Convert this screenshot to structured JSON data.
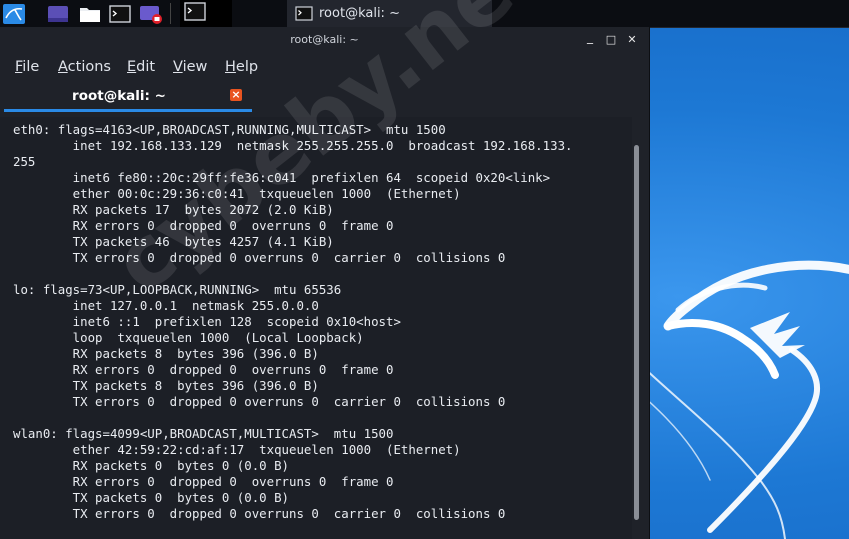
{
  "taskbar": {
    "window_task_title": "root@kali: ~",
    "icons": [
      "kali-menu-icon",
      "desktop-icon",
      "file-manager-icon",
      "terminal-icon",
      "screen-recorder-icon",
      "terminal-window-icon"
    ]
  },
  "window": {
    "title": "root@kali: ~",
    "controls": {
      "minimize": "_",
      "maximize": "□",
      "close": "✕"
    }
  },
  "menubar": {
    "items": [
      {
        "label": "File",
        "mnemonic": "F"
      },
      {
        "label": "Actions",
        "mnemonic": "A"
      },
      {
        "label": "Edit",
        "mnemonic": "E"
      },
      {
        "label": "View",
        "mnemonic": "V"
      },
      {
        "label": "Help",
        "mnemonic": "H"
      }
    ]
  },
  "tab": {
    "label": "root@kali: ~",
    "close_glyph": "×"
  },
  "terminal": {
    "lines": [
      "eth0: flags=4163<UP,BROADCAST,RUNNING,MULTICAST>  mtu 1500",
      "        inet 192.168.133.129  netmask 255.255.255.0  broadcast 192.168.133.",
      "255",
      "        inet6 fe80::20c:29ff:fe36:c041  prefixlen 64  scopeid 0x20<link>",
      "        ether 00:0c:29:36:c0:41  txqueuelen 1000  (Ethernet)",
      "        RX packets 17  bytes 2072 (2.0 KiB)",
      "        RX errors 0  dropped 0  overruns 0  frame 0",
      "        TX packets 46  bytes 4257 (4.1 KiB)",
      "        TX errors 0  dropped 0 overruns 0  carrier 0  collisions 0",
      "",
      "lo: flags=73<UP,LOOPBACK,RUNNING>  mtu 65536",
      "        inet 127.0.0.1  netmask 255.0.0.0",
      "        inet6 ::1  prefixlen 128  scopeid 0x10<host>",
      "        loop  txqueuelen 1000  (Local Loopback)",
      "        RX packets 8  bytes 396 (396.0 B)",
      "        RX errors 0  dropped 0  overruns 0  frame 0",
      "        TX packets 8  bytes 396 (396.0 B)",
      "        TX errors 0  dropped 0 overruns 0  carrier 0  collisions 0",
      "",
      "wlan0: flags=4099<UP,BROADCAST,MULTICAST>  mtu 1500",
      "        ether 42:59:22:cd:af:17  txqueuelen 1000  (Ethernet)",
      "        RX packets 0  bytes 0 (0.0 B)",
      "        RX errors 0  dropped 0  overruns 0  frame 0",
      "        TX packets 0  bytes 0 (0.0 B)",
      "        TX errors 0  dropped 0 overruns 0  carrier 0  collisions 0"
    ]
  },
  "watermark": "cybeby.net",
  "colors": {
    "accent": "#2a8ae6",
    "tab_close": "#e95420",
    "terminal_bg": "#1c1f26",
    "desktop_bg": "#1d78d4"
  }
}
